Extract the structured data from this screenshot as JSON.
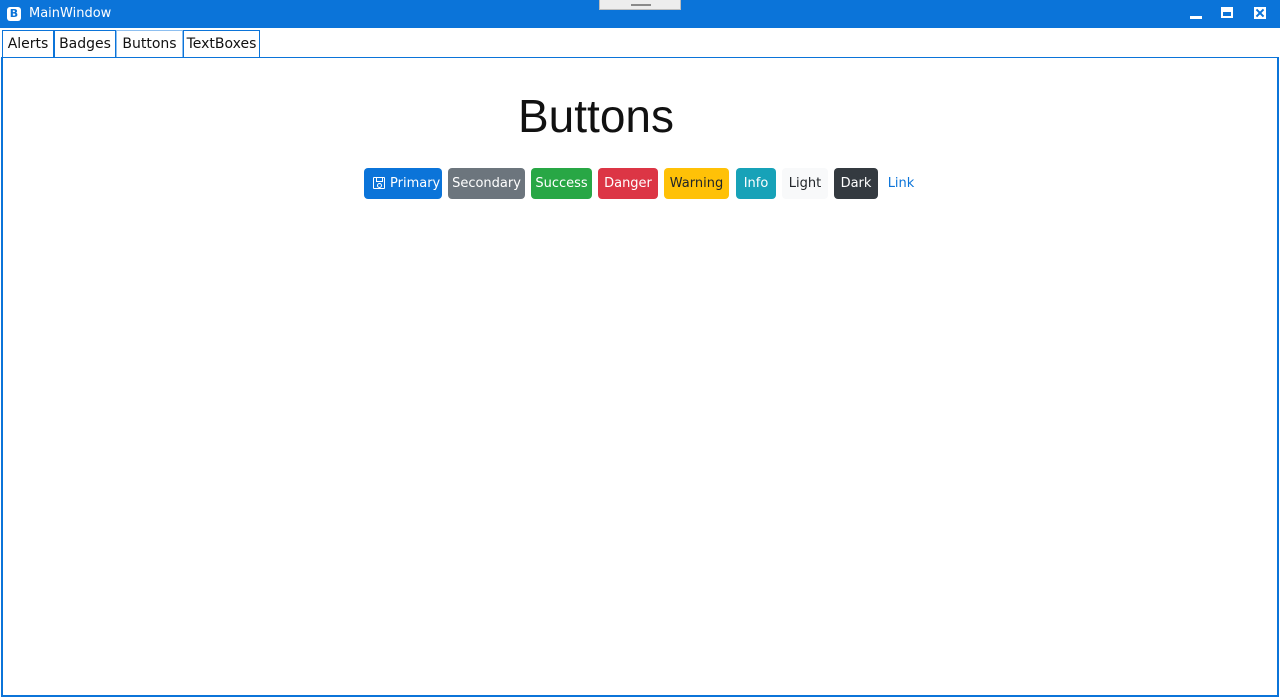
{
  "window": {
    "title": "MainWindow",
    "app_icon_letter": "B",
    "accent_color": "#0b74d9"
  },
  "tabs": [
    {
      "label": "Alerts",
      "active": false
    },
    {
      "label": "Badges",
      "active": false
    },
    {
      "label": "Buttons",
      "active": true
    },
    {
      "label": "TextBoxes",
      "active": false
    }
  ],
  "main": {
    "heading": "Buttons",
    "buttons": {
      "primary": {
        "label": "Primary",
        "icon": "save-icon",
        "color": "#0b74d9"
      },
      "secondary": {
        "label": "Secondary",
        "color": "#6c757d"
      },
      "success": {
        "label": "Success",
        "color": "#28a745"
      },
      "danger": {
        "label": "Danger",
        "color": "#dc3545"
      },
      "warning": {
        "label": "Warning",
        "color": "#ffc107"
      },
      "info": {
        "label": "Info",
        "color": "#17a2b8"
      },
      "light": {
        "label": "Light",
        "color": "#f8f9fa"
      },
      "dark": {
        "label": "Dark",
        "color": "#343a40"
      },
      "link": {
        "label": "Link",
        "color": "#0b74d9"
      }
    }
  }
}
